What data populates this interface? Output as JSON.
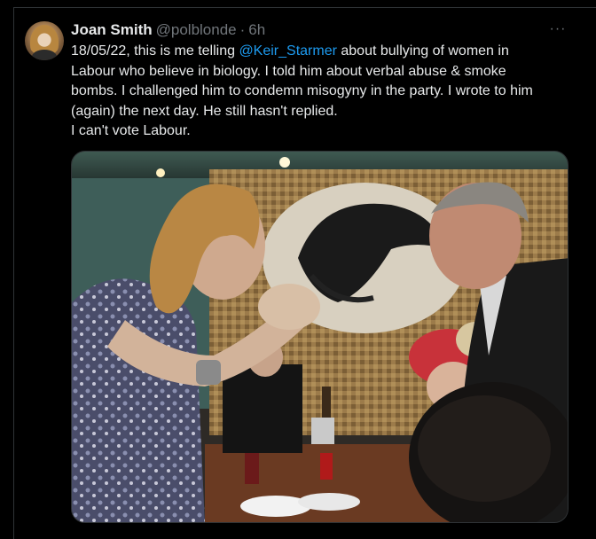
{
  "tweet": {
    "author_name": "Joan Smith",
    "author_handle": "@polblonde",
    "separator": "·",
    "time": "6h",
    "more_icon": "ellipsis-icon",
    "text_line1_pre": "18/05/22, this is me telling ",
    "mention": "@Keir_Starmer",
    "text_line1_post": " about bullying of women in",
    "text_line2": "Labour who believe in biology. I told him about verbal abuse & smoke",
    "text_line3": "bombs. I challenged him to condemn misogyny in the party. I wrote to him",
    "text_line4": "(again) the next day. He still hasn't replied.",
    "text_line5": "I can't vote Labour.",
    "more_label": "···"
  },
  "colors": {
    "background": "#000000",
    "text": "#e7e9ea",
    "secondary": "#71767b",
    "link": "#1d9bf0",
    "border": "#2f3336"
  },
  "media": {
    "type": "photo",
    "icon": "photo-icon"
  }
}
